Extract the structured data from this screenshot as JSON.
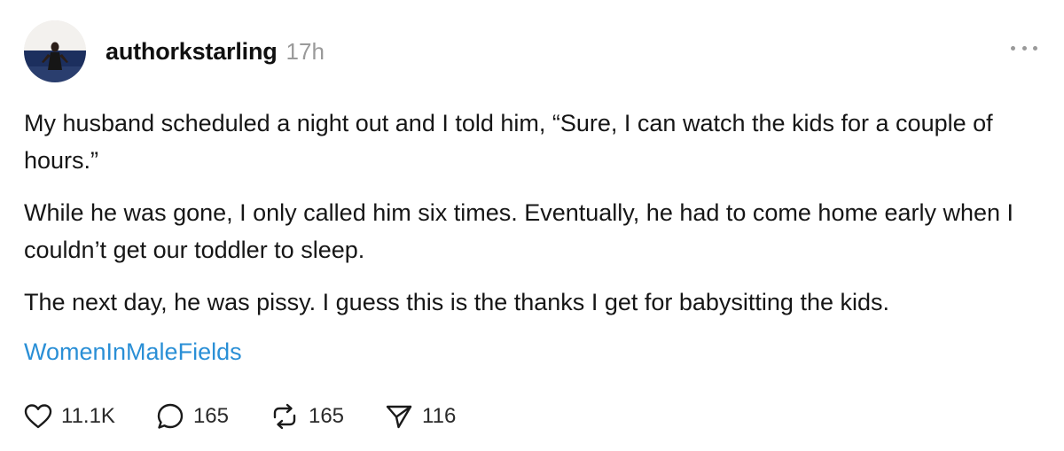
{
  "post": {
    "username": "authorkstarling",
    "time": "17h",
    "paragraphs": [
      "My husband scheduled a night out and I told him, “Sure, I can watch the kids for a couple of hours.”",
      "While he was gone, I only called him six times. Eventually, he had to come home early when I couldn’t get our toddler to sleep.",
      "The next day, he was pissy. I guess this is the thanks I get for babysitting the kids."
    ],
    "tag": "WomenInMaleFields"
  },
  "actions": {
    "like_count": "11.1K",
    "comment_count": "165",
    "repost_count": "165",
    "share_count": "116"
  },
  "colors": {
    "tag": "#2a8fd6",
    "muted": "#9a9a9a",
    "text": "#101010"
  },
  "icons": {
    "like": "heart-icon",
    "comment": "comment-bubble-icon",
    "repost": "repost-icon",
    "share": "send-icon",
    "more": "more-dots-icon"
  }
}
